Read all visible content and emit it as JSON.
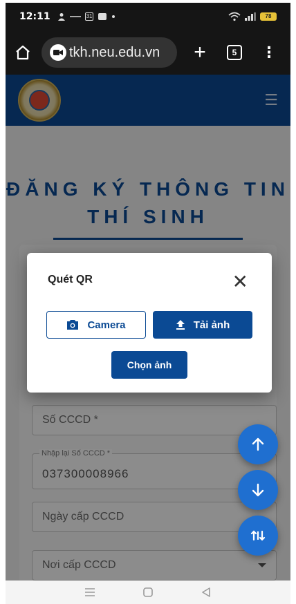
{
  "status_bar": {
    "time": "12:11",
    "battery": "78"
  },
  "browser": {
    "url": "tkh.neu.edu.vn",
    "tab_count": "5"
  },
  "page": {
    "title_line1": "ĐĂNG KÝ THÔNG TIN",
    "title_line2": "THÍ SINH"
  },
  "form": {
    "cccd_label": "Số CCCD *",
    "cccd_confirm_label": "Nhập lại Số CCCD *",
    "cccd_confirm_value": "037300008966",
    "issue_date_label": "Ngày cấp CCCD",
    "issue_place_label": "Nơi cấp CCCD"
  },
  "dialog": {
    "title": "Quét QR",
    "camera_label": "Camera",
    "upload_label": "Tải ảnh",
    "choose_label": "Chọn ảnh"
  },
  "colors": {
    "brand": "#0b4a94",
    "fab": "#1f6fd0"
  }
}
